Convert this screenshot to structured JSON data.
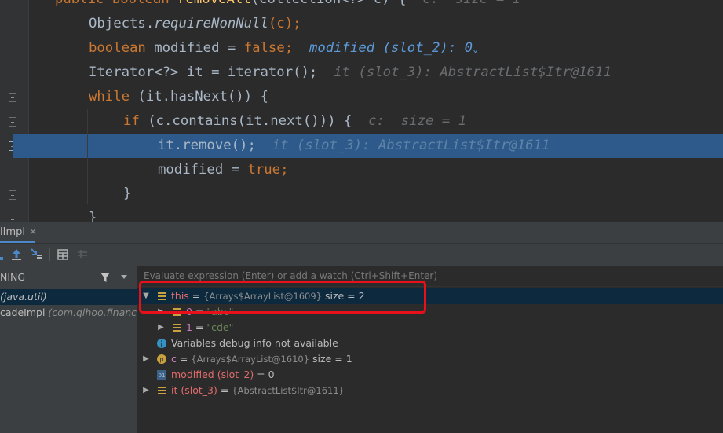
{
  "code": {
    "line0": {
      "kw1": "public",
      "kw2": "boolean",
      "name": "removeAll",
      "rest": "(Collection<?> c) {",
      "hint": "c:  size = 1"
    },
    "line1": {
      "text": "Objects.",
      "method": "requireNonNull",
      "rest": "(c);"
    },
    "line2": {
      "kw": "boolean",
      "mid": " modified = ",
      "val": "false",
      "semi": ";",
      "hint": "modified (slot_2): 0",
      "hint_caret": "⌄"
    },
    "line3": {
      "text": "Iterator<?> it = iterator();",
      "hint": "it (slot_3): AbstractList$Itr@1611"
    },
    "line4": {
      "kw": "while",
      "rest": " (it.hasNext()) {"
    },
    "line5": {
      "kw": "if",
      "rest": " (c.contains(it.next())) {",
      "hint": "c:  size = 1"
    },
    "line6": {
      "text": "it.remove();",
      "hint": "it (slot_3): AbstractList$Itr@1611"
    },
    "line7": {
      "mid": "modified = ",
      "val": "true",
      "semi": ";"
    },
    "line8": {
      "text": "}"
    },
    "line9": {
      "text": "}"
    }
  },
  "debug_tab": {
    "label": "lImpl",
    "close": "✕"
  },
  "frames": {
    "header": "NING",
    "items": [
      {
        "method": "",
        "class": "(java.util)"
      },
      {
        "method": "cadeImpl",
        "class": "(com.qihoo.finance."
      }
    ]
  },
  "variables": {
    "eval_placeholder": "Evaluate expression (Enter) or add a watch (Ctrl+Shift+Enter)",
    "rows": [
      {
        "name": "this",
        "eq": " = ",
        "ref": "{Arrays$ArrayList@1609}",
        "extra": "  size = 2"
      },
      {
        "name": "0",
        "eq": " = ",
        "val": "\"abc\""
      },
      {
        "name": "1",
        "eq": " = ",
        "val": "\"cde\""
      },
      {
        "text": "Variables debug info not available"
      },
      {
        "name": "c",
        "eq": " = ",
        "ref": "{Arrays$ArrayList@1610}",
        "extra": "  size = 1"
      },
      {
        "name": "modified (slot_2)",
        "eq": " = ",
        "val": "0"
      },
      {
        "name": "it (slot_3)",
        "eq": " = ",
        "ref": "{AbstractList$Itr@1611}"
      }
    ]
  },
  "colors": {
    "highlight": "#2d5a8a",
    "annotation_box": "#e8101a",
    "keyword": "#cc7832"
  }
}
